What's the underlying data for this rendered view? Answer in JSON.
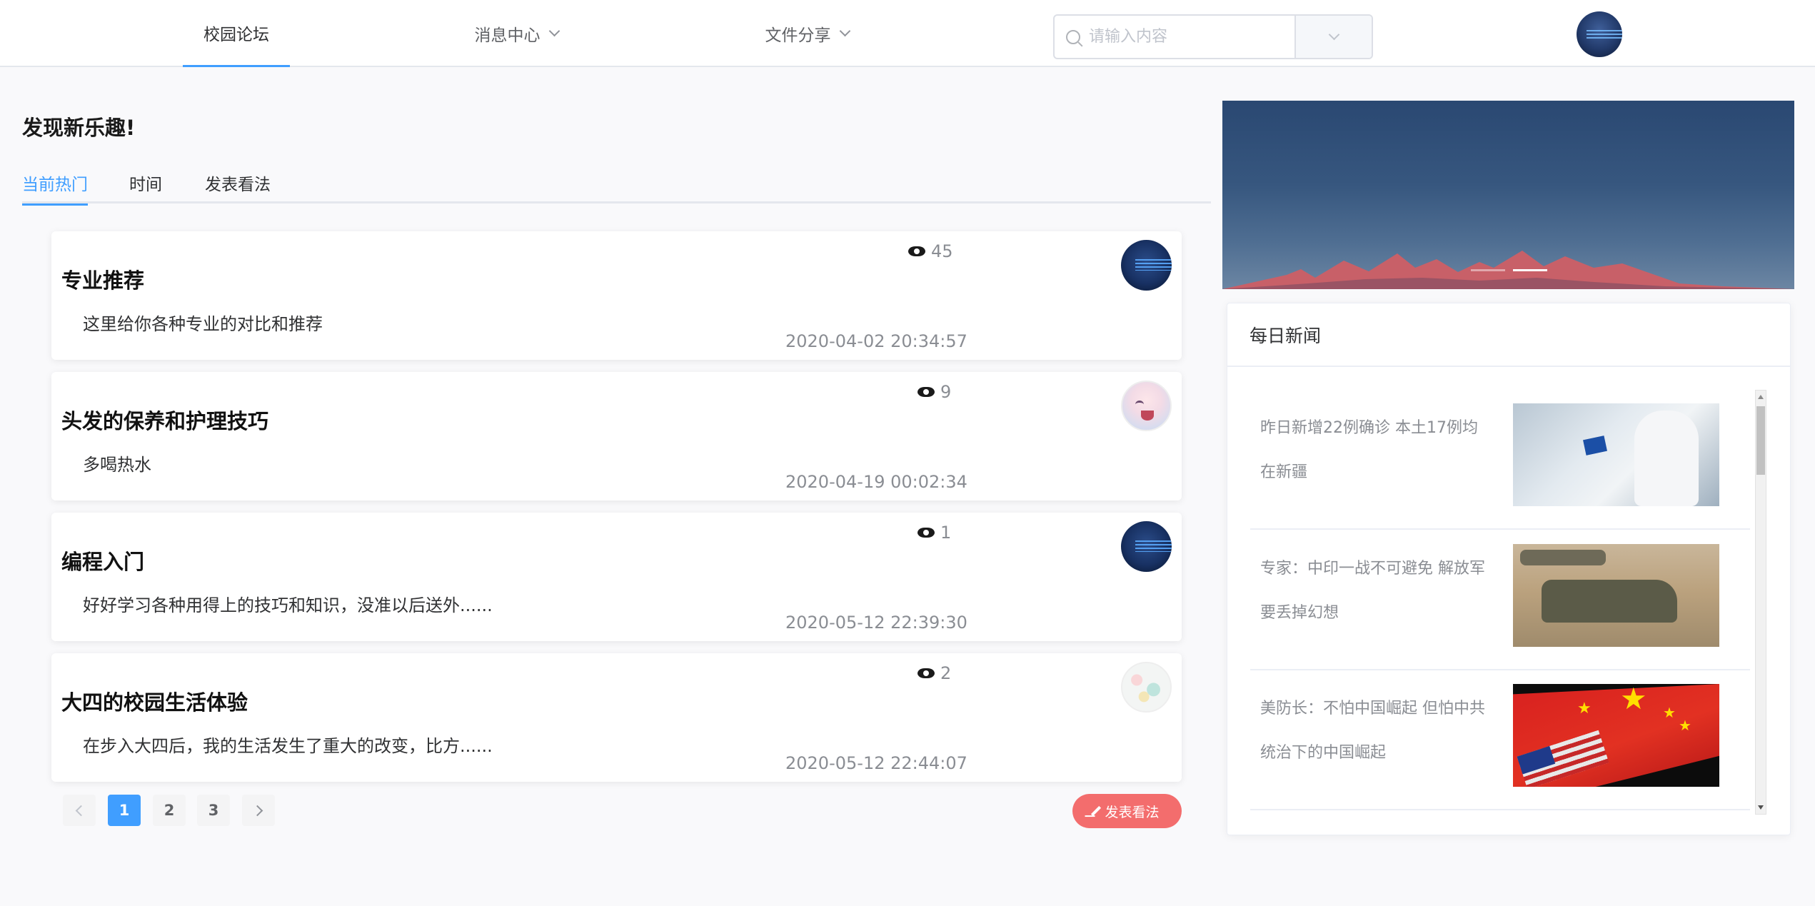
{
  "nav": {
    "items": [
      {
        "label": "校园论坛",
        "active": true
      },
      {
        "label": "消息中心",
        "has_dropdown": true
      },
      {
        "label": "文件分享",
        "has_dropdown": true
      }
    ],
    "search": {
      "placeholder": "请输入内容",
      "value": ""
    }
  },
  "main": {
    "title": "发现新乐趣!",
    "tabs": [
      {
        "label": "当前热门",
        "active": true
      },
      {
        "label": "时间"
      },
      {
        "label": "发表看法"
      }
    ],
    "posts": [
      {
        "title": "专业推荐",
        "excerpt": "这里给你各种专业的对比和推荐",
        "views": "45",
        "date": "2020-04-02 20:34:57",
        "avatar": "dark-galaxy-avatar"
      },
      {
        "title": "头发的保养和护理技巧",
        "excerpt": "多喝热水",
        "views": "9",
        "date": "2020-04-19 00:02:34",
        "avatar": "anime-girl-avatar"
      },
      {
        "title": "编程入门",
        "excerpt": "好好学习各种用得上的技巧和知识，没准以后送外......",
        "views": "1",
        "date": "2020-05-12 22:39:30",
        "avatar": "dark-galaxy-avatar"
      },
      {
        "title": "大四的校园生活体验",
        "excerpt": "在步入大四后，我的生活发生了重大的改变，比方......",
        "views": "2",
        "date": "2020-05-12 22:44:07",
        "avatar": "toys-avatar"
      }
    ],
    "pagination": {
      "pages": [
        "1",
        "2",
        "3"
      ],
      "current": "1"
    },
    "publish_button": "发表看法"
  },
  "sidebar": {
    "carousel": {
      "slide_count": 2,
      "active_slide": 2,
      "image": "mountain-landscape"
    },
    "news": {
      "title": "每日新闻",
      "items": [
        {
          "text": "昨日新增22例确诊 本土17例均在新疆",
          "image": "lab-worker-photo"
        },
        {
          "text": "专家：中印一战不可避免 解放军要丢掉幻想",
          "image": "tank-photo"
        },
        {
          "text": "美防长：不怕中国崛起 但怕中共统治下的中国崛起",
          "image": "flags-photo"
        }
      ]
    }
  },
  "colors": {
    "primary": "#409eff",
    "publish": "#f36d6d",
    "text_secondary": "#8a8d93",
    "background": "#f9f9fb"
  }
}
